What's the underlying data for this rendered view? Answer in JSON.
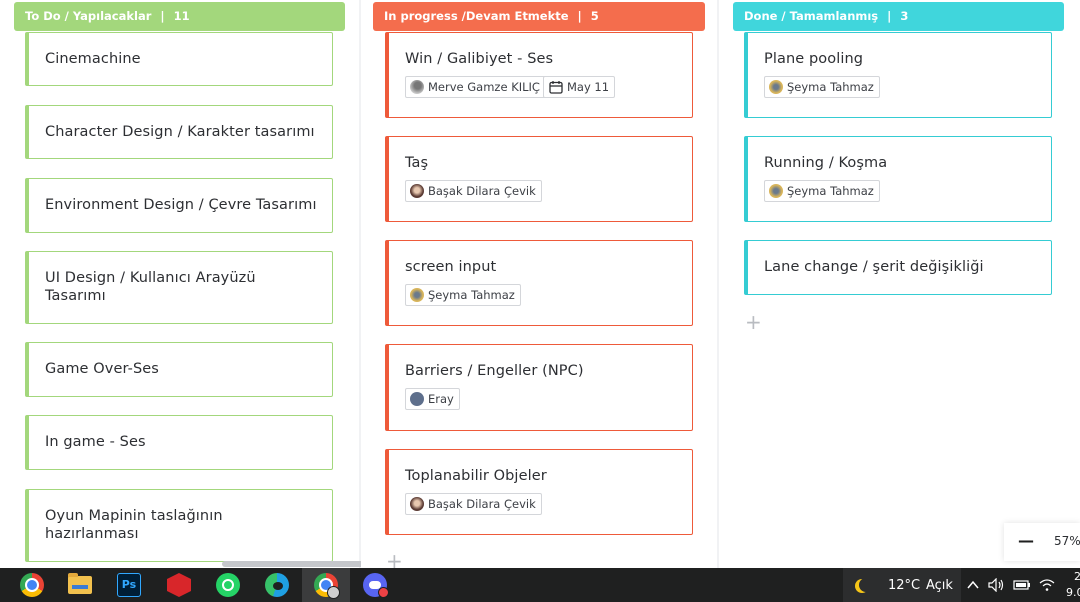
{
  "columns": [
    {
      "title": "To Do / Yapılacaklar",
      "count": "11",
      "color": "#a3d77c",
      "border": "#9bd46b",
      "cards": [
        {
          "title": "Cinemachine"
        },
        {
          "title": "Character Design / Karakter tasarımı"
        },
        {
          "title": "Environment Design / Çevre Tasarımı"
        },
        {
          "title": "UI Design / Kullanıcı Arayüzü Tasarımı"
        },
        {
          "title": "Game Over-Ses"
        },
        {
          "title": "In game - Ses"
        },
        {
          "title": "Oyun Mapinin taslağının hazırlanması"
        }
      ]
    },
    {
      "title": "In progress /Devam Etmekte",
      "count": "5",
      "color": "#f46d4d",
      "border": "#ee5a3a",
      "cards": [
        {
          "title": "Win / Galibiyet - Ses",
          "assignee": "Merve Gamze KILIÇ",
          "date": "May 11"
        },
        {
          "title": "Taş",
          "assignee": "Başak Dilara Çevik"
        },
        {
          "title": "screen input",
          "assignee": "Şeyma Tahmaz"
        },
        {
          "title": "Barriers / Engeller (NPC)",
          "assignee": "Eray"
        },
        {
          "title": "Toplanabilir Objeler",
          "assignee": "Başak Dilara Çevik"
        }
      ]
    },
    {
      "title": "Done / Tamamlanmış",
      "count": "3",
      "color": "#40d6dc",
      "border": "#35ccd3",
      "cards": [
        {
          "title": "Plane pooling",
          "assignee": "Şeyma Tahmaz"
        },
        {
          "title": "Running / Koşma",
          "assignee": "Şeyma Tahmaz"
        },
        {
          "title": "Lane change / şerit değişikliği"
        }
      ]
    }
  ],
  "add_symbol": "+",
  "zoom": {
    "minus": "—",
    "value": "57%"
  },
  "taskbar": {
    "icons": [
      "chrome-icon",
      "file-explorer-icon",
      "photoshop-icon",
      "sketchup-icon",
      "whatsapp-icon",
      "edge-icon",
      "chrome-profile-icon",
      "discord-icon"
    ],
    "photoshop_label": "Ps",
    "weather_temp": "12°C",
    "weather_text": "Açık",
    "clock_fragment_top": "2",
    "clock_fragment_bottom": "9.0"
  }
}
